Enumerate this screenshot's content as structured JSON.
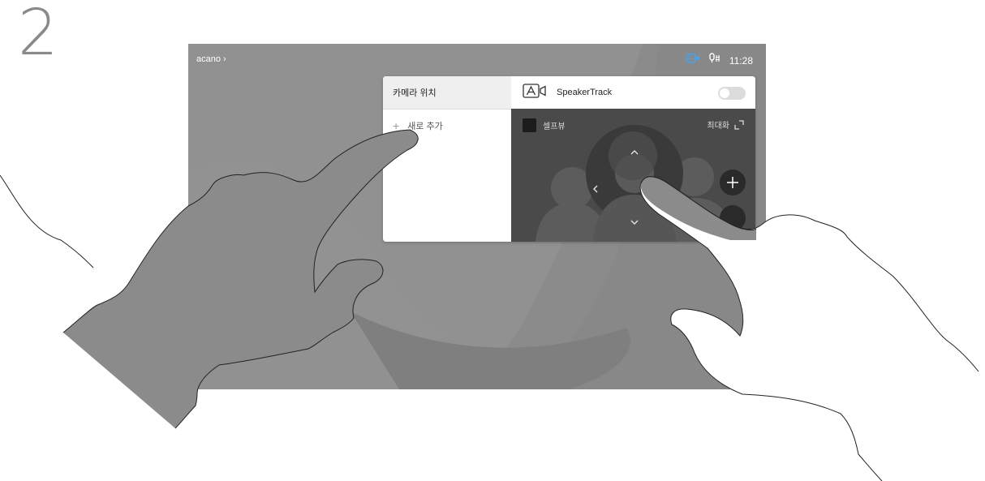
{
  "step": {
    "number": "2"
  },
  "status_bar": {
    "site_name": "acano",
    "time": "11:28",
    "icons": [
      "camera-icon",
      "microphone-icon"
    ]
  },
  "camera_panel": {
    "presets_title": "카메라 위치",
    "add_new_label": "새로 추가",
    "speakertrack_label": "SpeakerTrack",
    "speakertrack_enabled": false,
    "selfview_label": "셀프뷰",
    "maximize_label": "최대화",
    "icons": [
      "plus-icon",
      "speakertrack-icon",
      "maximize-icon",
      "chevron-up-icon",
      "chevron-down-icon",
      "chevron-left-icon",
      "zoom-in-icon"
    ]
  },
  "colors": {
    "screen_bg": "#8b8b8b",
    "selfview_bg": "#4a4a4a",
    "camera_icon_accent": "#4aa3e8"
  }
}
